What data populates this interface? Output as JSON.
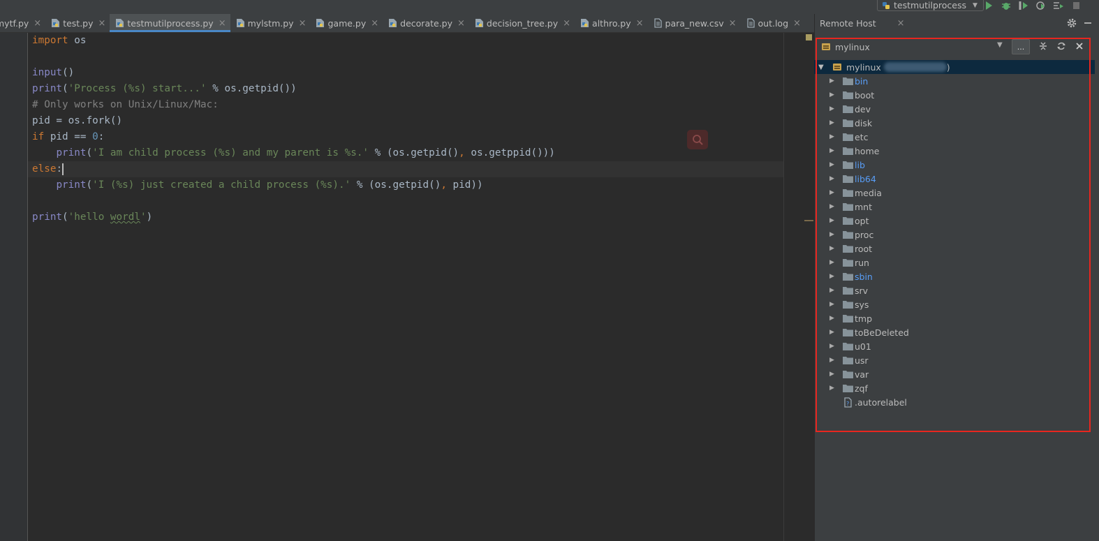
{
  "run_config": {
    "name": "testmutilprocess"
  },
  "tabs": [
    {
      "label": "mytf.py",
      "icon": "python-file-icon"
    },
    {
      "label": "test.py",
      "icon": "python-file-icon"
    },
    {
      "label": "testmutilprocess.py",
      "icon": "python-file-icon",
      "active": true
    },
    {
      "label": "mylstm.py",
      "icon": "python-file-icon"
    },
    {
      "label": "game.py",
      "icon": "python-file-icon"
    },
    {
      "label": "decorate.py",
      "icon": "python-file-icon"
    },
    {
      "label": "decision_tree.py",
      "icon": "python-file-icon"
    },
    {
      "label": "althro.py",
      "icon": "python-file-icon"
    },
    {
      "label": "para_new.csv",
      "icon": "text-file-icon"
    },
    {
      "label": "out.log",
      "icon": "text-file-icon"
    }
  ],
  "editor": {
    "lines": [
      "import os",
      "",
      "input()",
      "print('Process (%s) start...' % os.getpid())",
      "# Only works on Unix/Linux/Mac:",
      "pid = os.fork()",
      "if pid == 0:",
      "    print('I am child process (%s) and my parent is %s.' % (os.getpid(), os.getppid()))",
      "else:",
      "    print('I (%s) just created a child process (%s).' % (os.getpid(), pid))",
      "",
      "print('hello wordl')"
    ]
  },
  "panel": {
    "title": "Remote Host",
    "close_glyph": "×",
    "host": "mylinux",
    "more_label": "...",
    "root_label": "mylinux",
    "root_suffix": ")",
    "items": [
      {
        "label": "bin",
        "link": true
      },
      {
        "label": "boot",
        "link": false
      },
      {
        "label": "dev",
        "link": false
      },
      {
        "label": "disk",
        "link": false
      },
      {
        "label": "etc",
        "link": false
      },
      {
        "label": "home",
        "link": false
      },
      {
        "label": "lib",
        "link": true
      },
      {
        "label": "lib64",
        "link": true
      },
      {
        "label": "media",
        "link": false
      },
      {
        "label": "mnt",
        "link": false
      },
      {
        "label": "opt",
        "link": false
      },
      {
        "label": "proc",
        "link": false
      },
      {
        "label": "root",
        "link": false
      },
      {
        "label": "run",
        "link": false
      },
      {
        "label": "sbin",
        "link": true
      },
      {
        "label": "srv",
        "link": false
      },
      {
        "label": "sys",
        "link": false
      },
      {
        "label": "tmp",
        "link": false
      },
      {
        "label": "toBeDeleted",
        "link": false
      },
      {
        "label": "u01",
        "link": false
      },
      {
        "label": "usr",
        "link": false
      },
      {
        "label": "var",
        "link": false
      },
      {
        "label": "zqf",
        "link": false
      }
    ],
    "file": {
      "label": ".autorelabel",
      "icon": "unknown-file-icon"
    }
  },
  "colors": {
    "accent": "#4a88c7",
    "highlight_border": "#e8261f",
    "link_folder": "#589df6",
    "run_green": "#59a869"
  }
}
